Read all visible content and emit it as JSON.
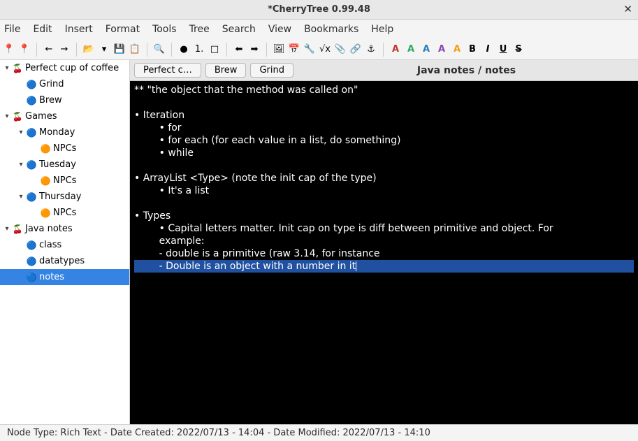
{
  "window": {
    "title": "*CherryTree 0.99.48"
  },
  "menu": [
    "File",
    "Edit",
    "Insert",
    "Format",
    "Tools",
    "Tree",
    "Search",
    "View",
    "Bookmarks",
    "Help"
  ],
  "toolbar_groups": [
    [
      "📍",
      "📍"
    ],
    [
      "←",
      "→"
    ],
    [
      "📂",
      "▾",
      "💾",
      "📋"
    ],
    [
      "🔍"
    ],
    [
      "●",
      "1.",
      "□"
    ],
    [
      "⬅",
      "➡"
    ],
    [
      "🖼",
      "📅",
      "🔧",
      "√x",
      "📎",
      "🔗",
      "⚓"
    ],
    [
      "A",
      "A",
      "A",
      "A",
      "A",
      "B",
      "I",
      "U",
      "S"
    ]
  ],
  "tree": [
    {
      "indent": 0,
      "caret": "▾",
      "icon": "🍒",
      "label": "Perfect cup of coffee"
    },
    {
      "indent": 1,
      "caret": "",
      "icon": "🔵",
      "label": "Grind"
    },
    {
      "indent": 1,
      "caret": "",
      "icon": "🔵",
      "label": "Brew"
    },
    {
      "indent": 0,
      "caret": "▾",
      "icon": "🍒",
      "label": "Games"
    },
    {
      "indent": 1,
      "caret": "▾",
      "icon": "🔵",
      "label": "Monday"
    },
    {
      "indent": 2,
      "caret": "",
      "icon": "🟠",
      "label": "NPCs"
    },
    {
      "indent": 1,
      "caret": "▾",
      "icon": "🔵",
      "label": "Tuesday"
    },
    {
      "indent": 2,
      "caret": "",
      "icon": "🟠",
      "label": "NPCs"
    },
    {
      "indent": 1,
      "caret": "▾",
      "icon": "🔵",
      "label": "Thursday"
    },
    {
      "indent": 2,
      "caret": "",
      "icon": "🟠",
      "label": "NPCs"
    },
    {
      "indent": 0,
      "caret": "▾",
      "icon": "🍒",
      "label": "Java notes"
    },
    {
      "indent": 1,
      "caret": "",
      "icon": "🔵",
      "label": "class"
    },
    {
      "indent": 1,
      "caret": "",
      "icon": "🔵",
      "label": "datatypes"
    },
    {
      "indent": 1,
      "caret": "",
      "icon": "🔵",
      "label": "notes",
      "selected": true
    }
  ],
  "tabs": [
    {
      "label": "Perfect c…"
    },
    {
      "label": "Brew"
    },
    {
      "label": "Grind"
    }
  ],
  "breadcrumb": "Java notes / notes",
  "editor_lines": [
    {
      "text": "** \"the object that the method was called on\""
    },
    {
      "text": ""
    },
    {
      "text": "• Iteration"
    },
    {
      "text": "        • for"
    },
    {
      "text": "        • for each (for each value in a list, do something)"
    },
    {
      "text": "        • while"
    },
    {
      "text": ""
    },
    {
      "text": "• ArrayList <Type> (note the init cap of the type)"
    },
    {
      "text": "        • It's a list"
    },
    {
      "text": ""
    },
    {
      "text": "• Types"
    },
    {
      "text": "        • Capital letters matter. Init cap on type is diff between primitive and object. For"
    },
    {
      "text": "        example:"
    },
    {
      "text": "        - double is a primitive (raw 3.14, for instance"
    },
    {
      "text": "        - Double is an object with a number in it",
      "highlighted": true,
      "caret": true
    }
  ],
  "statusbar": "Node Type: Rich Text  -  Date Created: 2022/07/13 - 14:04  -  Date Modified: 2022/07/13 - 14:10"
}
